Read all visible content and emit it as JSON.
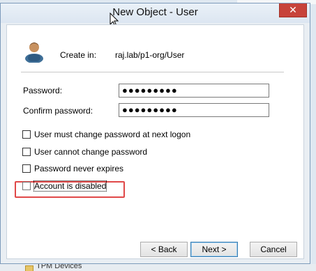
{
  "window": {
    "title": "New Object - User",
    "close_glyph": "✕"
  },
  "header": {
    "create_in_label": "Create in:",
    "create_in_path": "raj.lab/p1-org/User",
    "icon": "user-icon"
  },
  "form": {
    "password": {
      "label": "Password:",
      "value_masked": "●●●●●●●●●"
    },
    "confirm_password": {
      "label": "Confirm password:",
      "value_masked": "●●●●●●●●●"
    }
  },
  "options": [
    {
      "label": "User must change password at next logon",
      "checked": false
    },
    {
      "label": "User cannot change password",
      "checked": false
    },
    {
      "label": "Password never expires",
      "checked": false,
      "highlighted": true,
      "highlight_color": "#e04848"
    },
    {
      "label": "Account is disabled",
      "checked": false,
      "focused": true
    }
  ],
  "buttons": {
    "back": "< Back",
    "next": "Next >",
    "cancel": "Cancel"
  },
  "background": {
    "tree_item": "TPM Devices"
  }
}
